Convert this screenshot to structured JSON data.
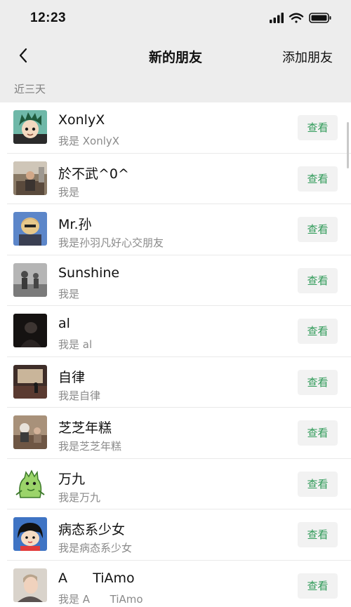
{
  "status_bar": {
    "time": "12:23",
    "icons": [
      "signal-icon",
      "wifi-icon",
      "battery-icon"
    ]
  },
  "nav": {
    "back_icon": "chevron-left-icon",
    "title": "新的朋友",
    "action": "添加朋友"
  },
  "section": {
    "label": "近三天"
  },
  "colors": {
    "accent": "#2f9a58",
    "background": "#ededed",
    "secondary_text": "#8a8a8a"
  },
  "friends": [
    {
      "name": "XonlyX",
      "message": "我是 XonlyX",
      "button": "查看",
      "avatar": "anime-boy-green-hair"
    },
    {
      "name": "於不武^0^",
      "message": "我是",
      "button": "查看",
      "avatar": "photo-person-room"
    },
    {
      "name": "Mr.孙",
      "message": "我是孙羽凡好心交朋友",
      "button": "查看",
      "avatar": "anime-character-blue"
    },
    {
      "name": "Sunshine",
      "message": "我是",
      "button": "查看",
      "avatar": "photo-grayscale"
    },
    {
      "name": "al",
      "message": "我是 al",
      "button": "查看",
      "avatar": "photo-dark"
    },
    {
      "name": "自律",
      "message": "我是自律",
      "button": "查看",
      "avatar": "photo-indoor-window"
    },
    {
      "name": "芝芝年糕",
      "message": "我是芝芝年糕",
      "button": "查看",
      "avatar": "photo-people-cafe"
    },
    {
      "name": "万九",
      "message": "我是万九",
      "button": "查看",
      "avatar": "cartoon-green-dinosaur"
    },
    {
      "name": "病态系少女",
      "message": "我是病态系少女",
      "button": "查看",
      "avatar": "cartoon-girl-red-shirt"
    },
    {
      "name": "A      TiAmo",
      "message": "我是 A      TiAmo",
      "button": "查看",
      "avatar": "photo-person-portrait"
    }
  ]
}
